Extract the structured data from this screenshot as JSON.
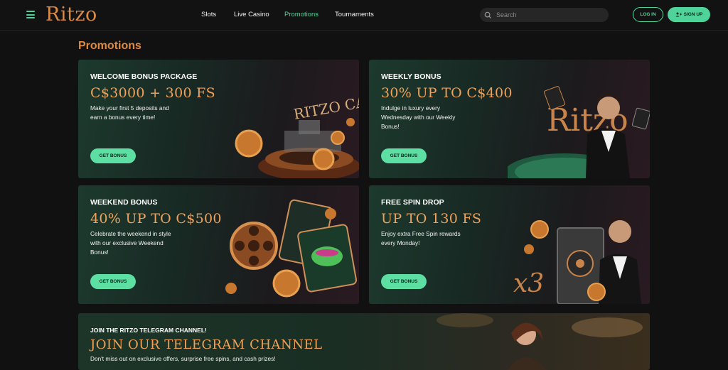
{
  "header": {
    "logo": "Ritzo",
    "nav": [
      {
        "label": "Slots",
        "active": false
      },
      {
        "label": "Live Casino",
        "active": false
      },
      {
        "label": "Promotions",
        "active": true
      },
      {
        "label": "Tournaments",
        "active": false
      }
    ],
    "search_placeholder": "Search",
    "login_label": "LOG IN",
    "signup_label": "SIGN UP"
  },
  "page_title": "Promotions",
  "cards": [
    {
      "eyebrow": "WELCOME BONUS PACKAGE",
      "headline": "C$3000 + 300 FS",
      "desc": "Make your first 5 deposits and earn a bonus every time!",
      "cta": "GET BONUS",
      "art_text": "RITZO CASINO TOP"
    },
    {
      "eyebrow": "WEEKLY BONUS",
      "headline": "30% UP TO C$400",
      "desc": "Indulge in luxury every Wednesday with our Weekly Bonus!",
      "cta": "GET BONUS",
      "art_text": "Ritzo"
    },
    {
      "eyebrow": "WEEKEND BONUS",
      "headline": "40% UP TO C$500",
      "desc": "Celebrate the weekend in style with our exclusive Weekend Bonus!",
      "cta": "GET BONUS"
    },
    {
      "eyebrow": "FREE SPIN DROP",
      "headline": "UP TO 130 FS",
      "desc": "Enjoy extra Free Spin rewards every Monday!",
      "cta": "GET BONUS",
      "art_text": "x3"
    }
  ],
  "telegram": {
    "eyebrow": "JOIN THE RITZO TELEGRAM CHANNEL!",
    "headline": "JOIN OUR TELEGRAM CHANNEL",
    "desc": "Don't miss out on exclusive offers, surprise free spins, and cash prizes!"
  },
  "colors": {
    "accent": "#4fd39a",
    "gold": "#f0a25a",
    "title": "#e08a3f",
    "background": "#111111"
  }
}
